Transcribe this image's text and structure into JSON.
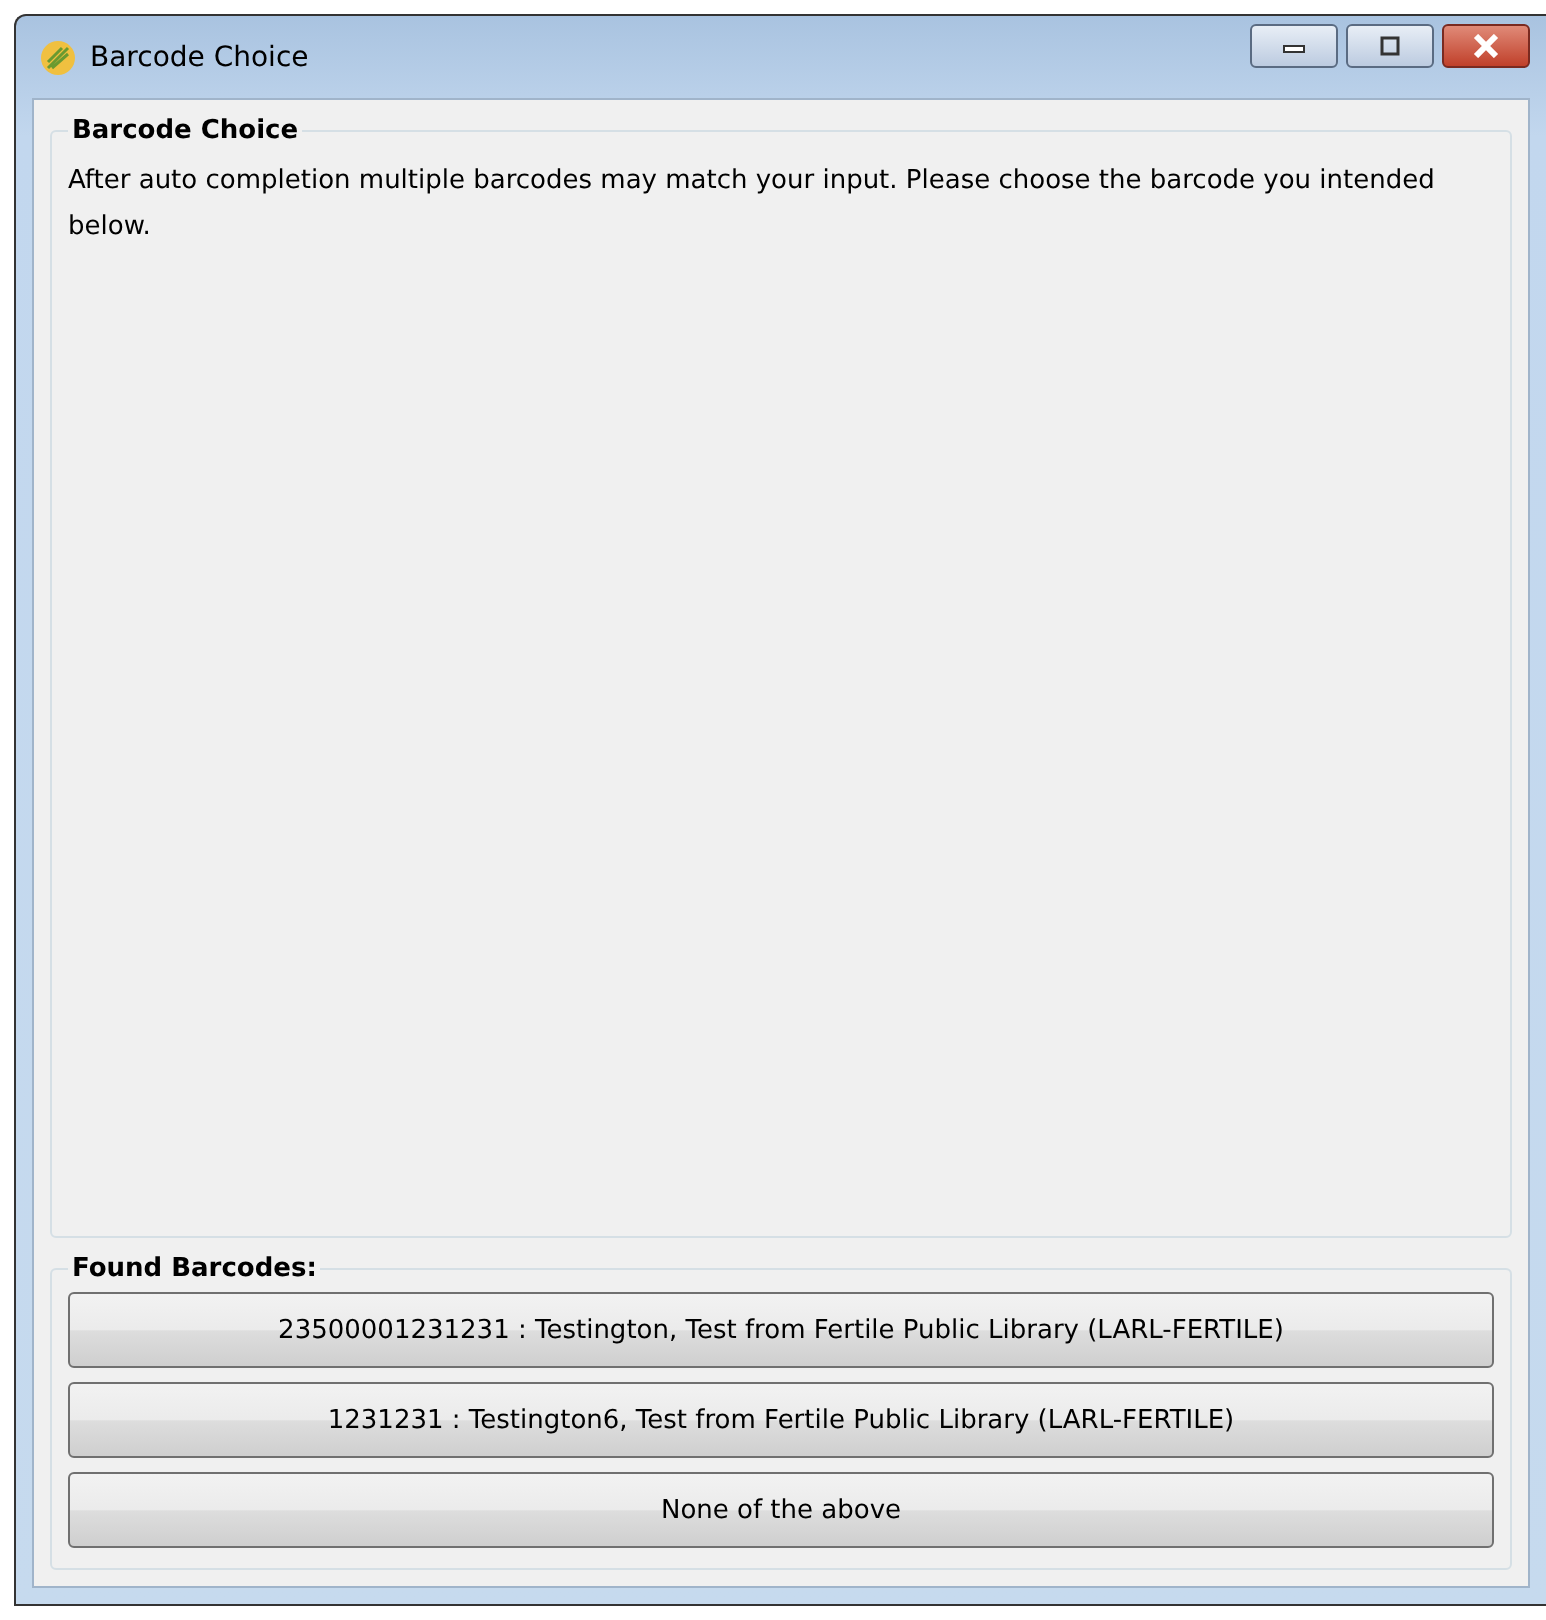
{
  "window": {
    "title": "Barcode Choice"
  },
  "info_group": {
    "title": "Barcode Choice",
    "text": "After auto completion multiple barcodes may match your input. Please choose the barcode you intended below."
  },
  "found_group": {
    "title": "Found Barcodes:",
    "buttons": [
      {
        "label": "23500001231231 : Testington, Test from Fertile Public Library (LARL-FERTILE)"
      },
      {
        "label": "1231231 : Testington6, Test from Fertile Public Library (LARL-FERTILE)"
      },
      {
        "label": "None of the above"
      }
    ]
  }
}
